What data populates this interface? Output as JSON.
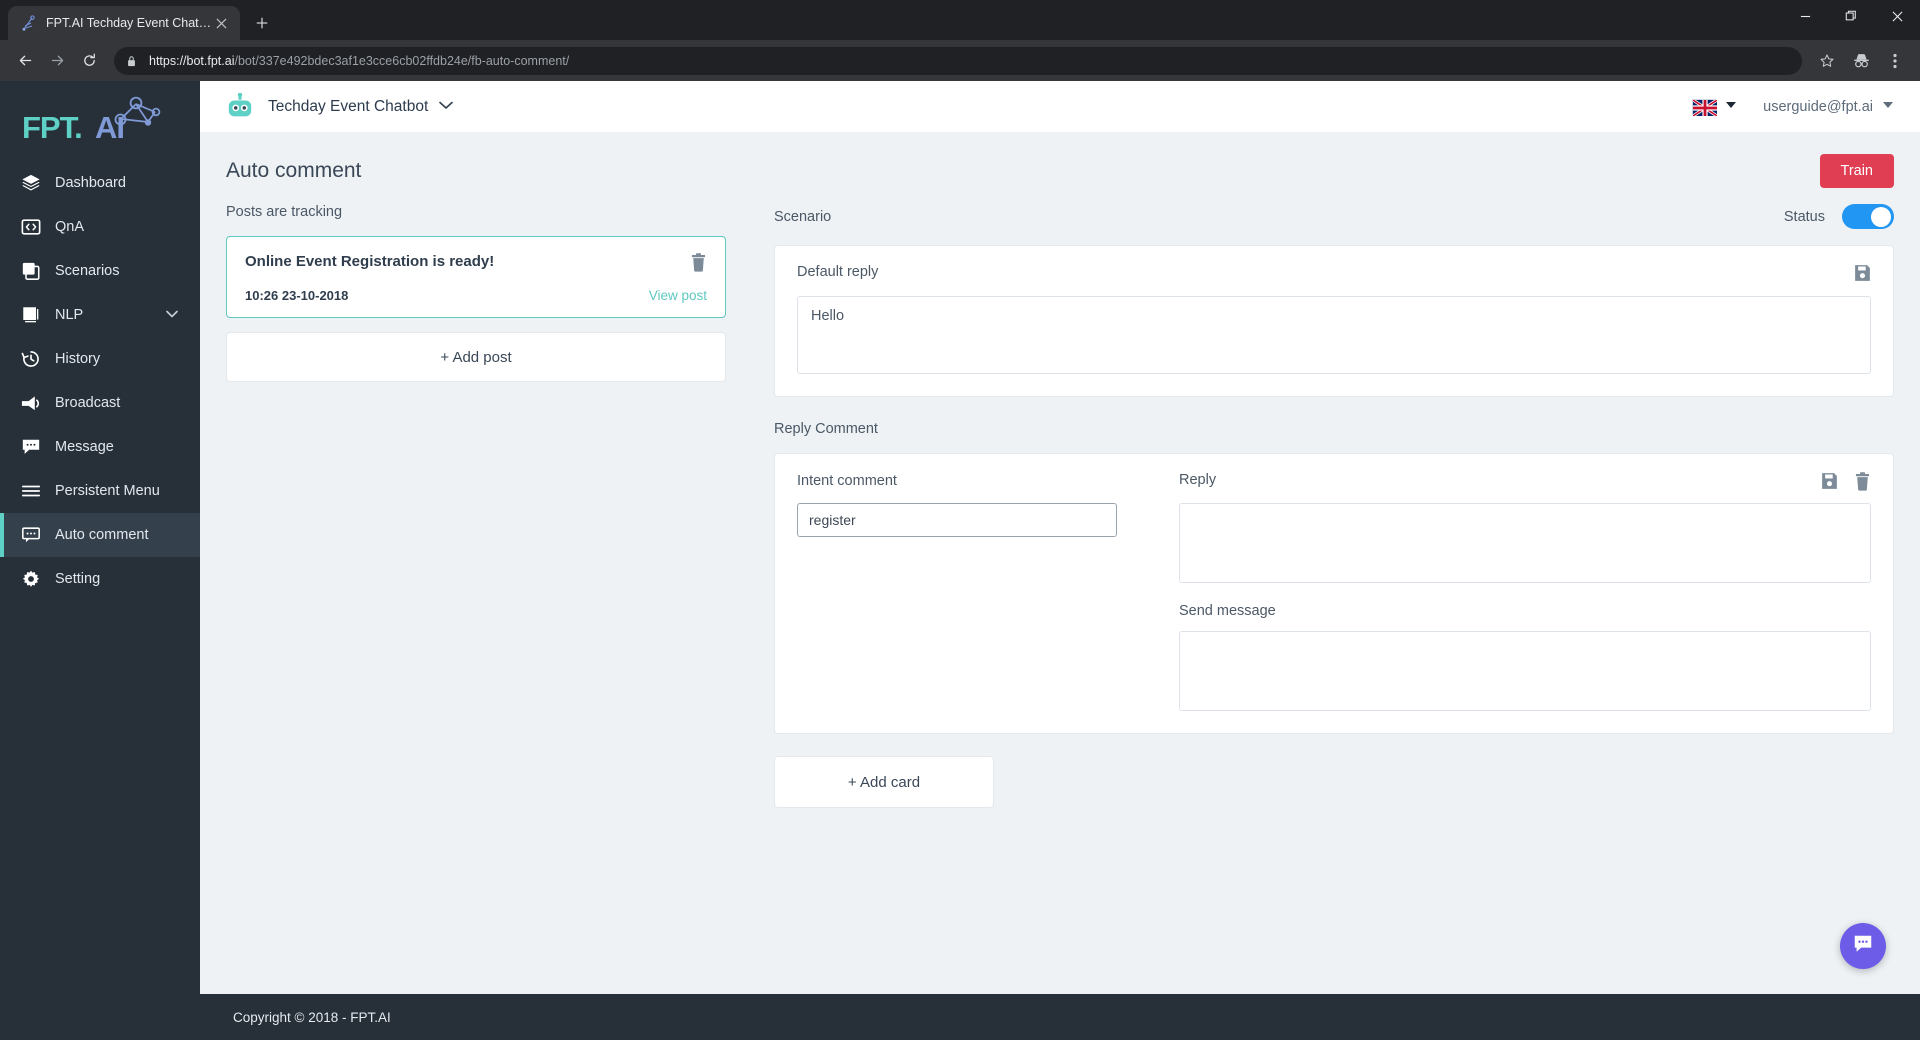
{
  "browser": {
    "tab": {
      "title": "FPT.AI Techday Event Chatbot",
      "favicon_icon": "site-favicon",
      "close_icon": "close-icon"
    },
    "new_tab_icon": "plus-icon",
    "window_controls": {
      "minimize_icon": "minimize-icon",
      "maximize_icon": "maximize-icon",
      "close_icon": "window-close-icon"
    },
    "nav": {
      "back_icon": "back-arrow-icon",
      "forward_icon": "forward-arrow-icon",
      "reload_icon": "reload-icon"
    },
    "omnibox": {
      "lock_icon": "lock-icon",
      "scheme": "https://",
      "host": "bot.fpt.ai",
      "path": "/bot/337e492bdec3af1e3cce6cb02ffdb24e/fb-auto-comment/"
    },
    "actions": {
      "bookmark_icon": "star-icon",
      "incognito_icon": "incognito-icon",
      "menu_icon": "kebab-menu-icon"
    }
  },
  "sidebar": {
    "logo_text": "FPT.AI",
    "items": [
      {
        "label": "Dashboard",
        "icon": "layers-icon",
        "active": false,
        "chevron": ""
      },
      {
        "label": "QnA",
        "icon": "code-brackets-icon",
        "active": false,
        "chevron": ""
      },
      {
        "label": "Scenarios",
        "icon": "copy-squares-icon",
        "active": false,
        "chevron": ""
      },
      {
        "label": "NLP",
        "icon": "chip-icon",
        "active": false,
        "chevron": "chevron-down-icon"
      },
      {
        "label": "History",
        "icon": "clock-history-icon",
        "active": false,
        "chevron": ""
      },
      {
        "label": "Broadcast",
        "icon": "megaphone-icon",
        "active": false,
        "chevron": ""
      },
      {
        "label": "Message",
        "icon": "chat-bubble-icon",
        "active": false,
        "chevron": ""
      },
      {
        "label": "Persistent Menu",
        "icon": "hamburger-lines-icon",
        "active": false,
        "chevron": ""
      },
      {
        "label": "Auto comment",
        "icon": "comment-dots-icon",
        "active": true,
        "chevron": ""
      },
      {
        "label": "Setting",
        "icon": "gear-icon",
        "active": false,
        "chevron": ""
      }
    ]
  },
  "header": {
    "bot_icon": "robot-icon",
    "bot_name": "Techday Event Chatbot",
    "bot_caret_icon": "chevron-down-icon",
    "language_flag": "union-jack-flag",
    "language_caret_icon": "caret-down-icon",
    "user_email": "userguide@fpt.ai",
    "user_caret_icon": "caret-down-icon"
  },
  "page": {
    "title": "Auto comment",
    "train_label": "Train",
    "train_color": "#e03e52"
  },
  "posts_panel": {
    "section_label": "Posts are tracking",
    "selected_border_color": "#5fc8c0",
    "post": {
      "title": "Online Event Registration is ready!",
      "timestamp": "10:26 23-10-2018",
      "view_post_label": "View post",
      "delete_icon": "trash-icon"
    },
    "add_post_label": "+ Add post"
  },
  "scenario": {
    "section_label": "Scenario",
    "status_label": "Status",
    "status_on": true,
    "status_color": "#2196f3",
    "default_reply": {
      "label": "Default reply",
      "value": "Hello",
      "placeholder": "",
      "save_icon": "save-icon"
    }
  },
  "reply_comment": {
    "section_label": "Reply Comment",
    "card": {
      "intent_label": "Intent comment",
      "intent_value": "register",
      "intent_placeholder": "",
      "reply_label": "Reply",
      "reply_value": "",
      "reply_placeholder": "",
      "send_message_label": "Send message",
      "send_message_value": "",
      "send_message_placeholder": "",
      "save_icon": "save-icon",
      "delete_icon": "trash-icon"
    },
    "add_card_label": "+ Add card"
  },
  "footer": {
    "copyright": "Copyright © 2018 - FPT.AI"
  },
  "fab": {
    "icon": "chat-dots-icon",
    "color": "#6c5ce7"
  }
}
